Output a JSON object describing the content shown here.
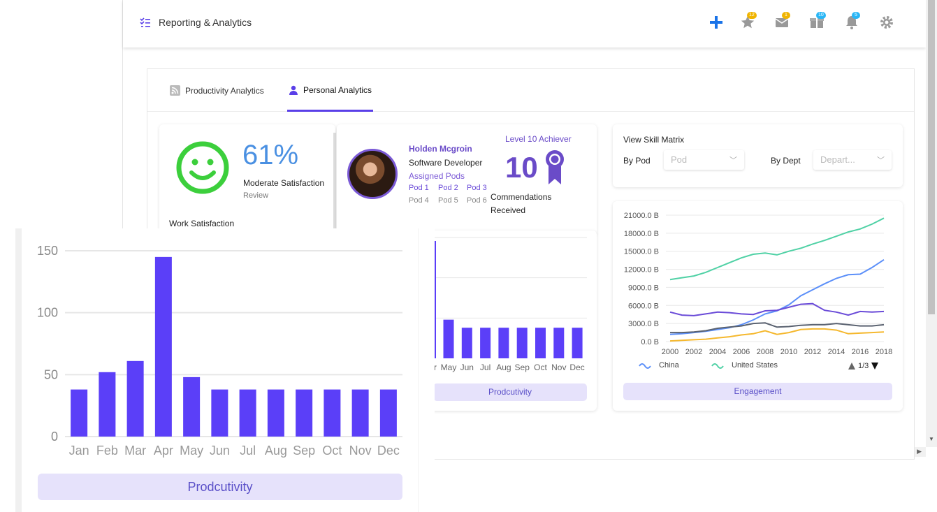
{
  "header": {
    "title": "Reporting & Analytics",
    "badges": {
      "favorites": "12",
      "messages": "1",
      "gifts": "10",
      "notifications": "5"
    },
    "colors": {
      "plus": "#1a73e8",
      "badge_yellow": "#f0b400",
      "badge_blue": "#29b6f6"
    }
  },
  "tabs": [
    {
      "label": "Productivity Analytics",
      "icon": "rss-icon",
      "active": false
    },
    {
      "label": "Personal Analytics",
      "icon": "user-icon",
      "active": true
    }
  ],
  "satisfaction": {
    "percent": "61%",
    "label": "Moderate Satisfaction",
    "sub": "Review",
    "footer": "Work Satisfaction"
  },
  "profile": {
    "name": "Holden Mcgroin",
    "role": "Software Developer",
    "pods_heading": "Assigned Pods",
    "pods": [
      "Pod 1",
      "Pod 2",
      "Pod 3",
      "Pod 4",
      "Pod 5",
      "Pod 6"
    ],
    "level": "Level 10 Achiever",
    "commendations_count": "10",
    "commendations_label": "Commendations Received"
  },
  "skill_matrix": {
    "title": "View Skill Matrix",
    "by_pod_label": "By Pod",
    "pod_placeholder": "Pod",
    "by_dept_label": "By Dept",
    "dept_placeholder": "Depart..."
  },
  "productivity_button": "Prodcutivity",
  "engagement_button": "Engagement",
  "chart_data": [
    {
      "type": "bar",
      "categories": [
        "Jan",
        "Feb",
        "Mar",
        "Apr",
        "May",
        "Jun",
        "Jul",
        "Aug",
        "Sep",
        "Oct",
        "Nov",
        "Dec"
      ],
      "values": [
        38,
        52,
        61,
        145,
        48,
        38,
        38,
        38,
        38,
        38,
        38,
        38
      ],
      "yticks": [
        "0",
        "50",
        "100",
        "150"
      ],
      "ylim": [
        0,
        160
      ],
      "color": "#5b3ff8",
      "grid": true
    },
    {
      "type": "line",
      "x": [
        2000,
        2001,
        2002,
        2003,
        2004,
        2005,
        2006,
        2007,
        2008,
        2009,
        2010,
        2011,
        2012,
        2013,
        2014,
        2015,
        2016,
        2017,
        2018
      ],
      "xticks": [
        "2000",
        "2002",
        "2004",
        "2006",
        "2008",
        "2010",
        "2012",
        "2014",
        "2016",
        "2018"
      ],
      "yticks": [
        "0.0 B",
        "3000.0 B",
        "6000.0 B",
        "9000.0 B",
        "12000.0 B",
        "15000.0 B",
        "18000.0 B",
        "21000.0 B"
      ],
      "ylim": [
        0,
        21000
      ],
      "series": [
        {
          "name": "United States",
          "color": "#4fd1a5",
          "values": [
            10300,
            10600,
            10900,
            11500,
            12300,
            13100,
            13900,
            14500,
            14700,
            14400,
            15000,
            15500,
            16200,
            16800,
            17500,
            18200,
            18700,
            19500,
            20500
          ]
        },
        {
          "name": "China",
          "color": "#5b8ff9",
          "values": [
            1200,
            1300,
            1500,
            1700,
            2000,
            2300,
            2800,
            3600,
            4600,
            5100,
            6100,
            7600,
            8600,
            9600,
            10500,
            11100,
            11200,
            12300,
            13600
          ]
        },
        {
          "color": "#6a4bd8",
          "values": [
            4900,
            4400,
            4300,
            4600,
            4900,
            4800,
            4600,
            4500,
            5100,
            5200,
            5700,
            6200,
            6300,
            5200,
            4900,
            4400,
            5000,
            4900,
            5000
          ]
        },
        {
          "color": "#5a6270",
          "values": [
            1500,
            1500,
            1600,
            1800,
            2200,
            2400,
            2600,
            3000,
            3100,
            2400,
            2500,
            2700,
            2800,
            2800,
            3000,
            2800,
            2600,
            2600,
            2800
          ]
        },
        {
          "color": "#f5b82e",
          "values": [
            100,
            200,
            300,
            400,
            600,
            800,
            1100,
            1300,
            1800,
            1200,
            1500,
            2000,
            2100,
            2100,
            1900,
            1300,
            1400,
            1500,
            1600
          ]
        }
      ],
      "legend": {
        "items": [
          "China",
          "United States"
        ],
        "page": "1/3",
        "position": "bottom"
      }
    }
  ]
}
